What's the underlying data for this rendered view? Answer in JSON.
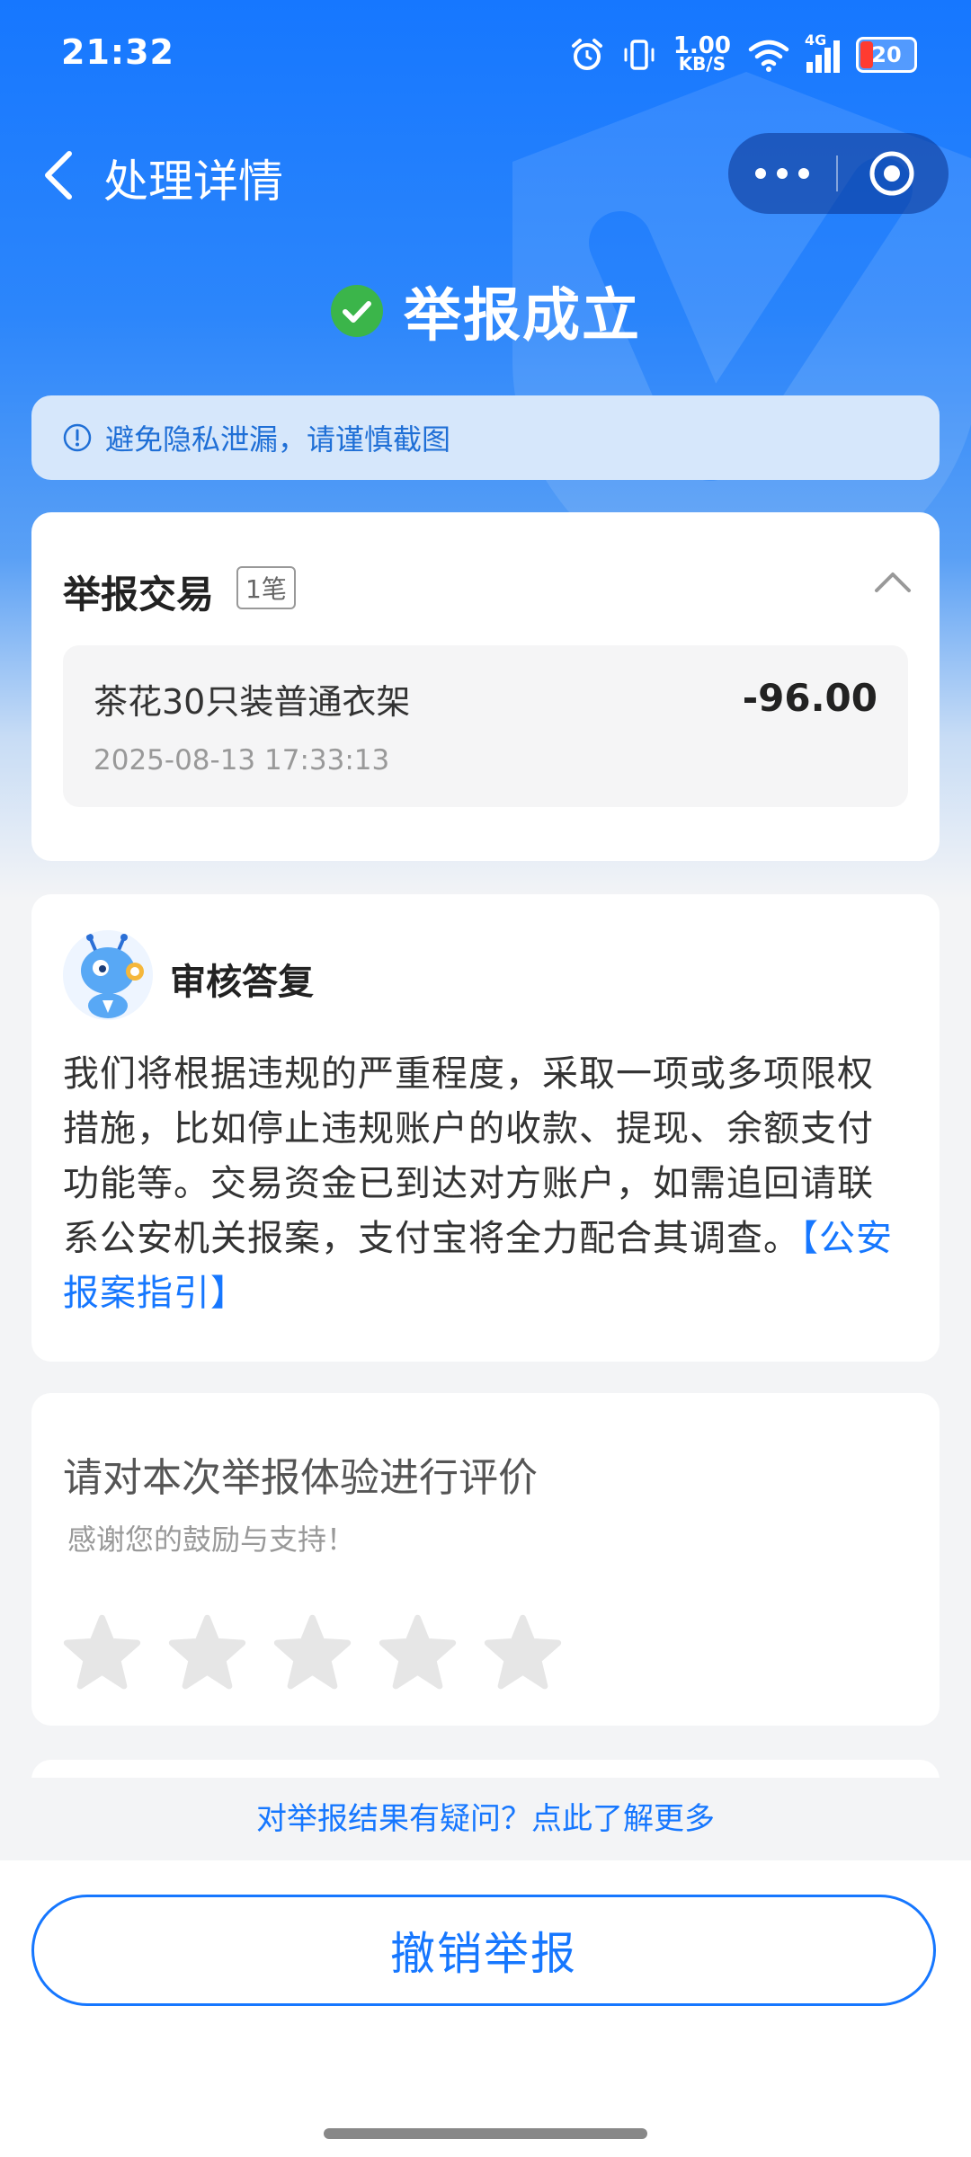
{
  "status_bar": {
    "time": "21:32",
    "net_speed_value": "1.00",
    "net_speed_unit": "KB/S",
    "network_type": "4G",
    "battery": "20"
  },
  "nav": {
    "title": "处理详情"
  },
  "result": {
    "title": "举报成立"
  },
  "notice": {
    "text": "避免隐私泄漏，请谨慎截图"
  },
  "transaction": {
    "title": "举报交易",
    "count_badge": "1笔",
    "item": {
      "name": "茶花30只装普通衣架",
      "amount": "-96.00",
      "time": "2025-08-13 17:33:13"
    }
  },
  "review": {
    "title": "审核答复",
    "body": "我们将根据违规的严重程度，采取一项或多项限权措施，比如停止违规账户的收款、提现、余额支付功能等。交易资金已到达对方账户，如需追回请联系公安机关报案，支付宝将全力配合其调查。",
    "link": "【公安报案指引】"
  },
  "rating": {
    "title": "请对本次举报体验进行评价",
    "subtitle": "感谢您的鼓励与支持！",
    "stars_total": 5,
    "stars_selected": 0
  },
  "footer": {
    "faq_link": "对举报结果有疑问？点此了解更多",
    "cancel_button": "撤销举报"
  },
  "colors": {
    "primary": "#1677ff",
    "success": "#3bb54a",
    "star_empty": "#e6e6e6"
  }
}
